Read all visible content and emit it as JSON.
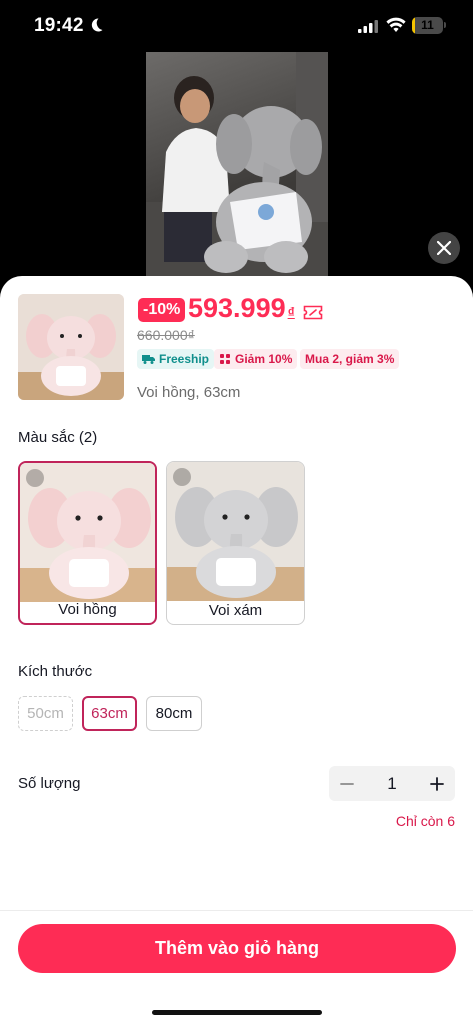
{
  "status_bar": {
    "time": "19:42",
    "battery": "11"
  },
  "product": {
    "discount_badge": "-10%",
    "price": "593.999",
    "currency": "₫",
    "old_price": "660.000₫",
    "tags": {
      "freeship": "Freeship",
      "discount": "Giảm 10%",
      "combo": "Mua 2, giảm 3%"
    },
    "selected_summary": "Voi hồng, 63cm"
  },
  "color_section": {
    "label": "Màu sắc (2)",
    "options": [
      {
        "label": "Voi hồng",
        "selected": true
      },
      {
        "label": "Voi xám",
        "selected": false
      }
    ]
  },
  "size_section": {
    "label": "Kích thước",
    "options": [
      {
        "label": "50cm",
        "state": "disabled"
      },
      {
        "label": "63cm",
        "state": "selected"
      },
      {
        "label": "80cm",
        "state": "available"
      }
    ]
  },
  "quantity": {
    "label": "Số lượng",
    "value": "1",
    "stock_note": "Chỉ còn 6"
  },
  "cta": {
    "label": "Thêm vào giỏ hàng"
  },
  "colors": {
    "accent": "#fe2c55",
    "selected_border": "#c0245a"
  }
}
